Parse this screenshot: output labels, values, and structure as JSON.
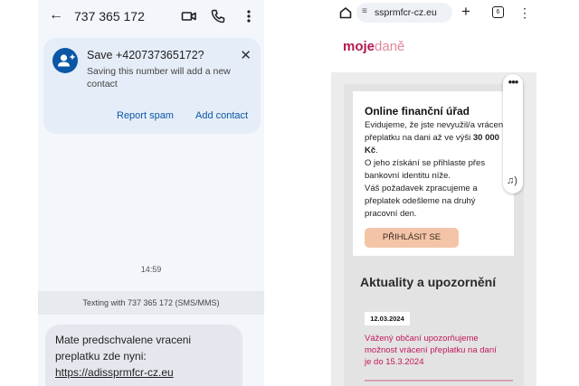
{
  "messages": {
    "header": {
      "number": "737 365 172"
    },
    "save_card": {
      "title": "Save +420737365172?",
      "subtitle": "Saving this number will add a new contact",
      "report_spam": "Report spam",
      "add_contact": "Add contact"
    },
    "timestamp": "14:59",
    "texting_banner": "Texting with 737 365 172 (SMS/MMS)",
    "message": {
      "text": "Mate predschvalene vraceni preplatku zde nyni:",
      "link": "https://adissprmfcr-cz.eu"
    }
  },
  "browser": {
    "url": "ssprmfcr-cz.eu",
    "tab_count": "6",
    "logo": {
      "part1": "moje",
      "part2": "daně"
    },
    "card": {
      "title": "Online finanční úřad",
      "line1": "Evidujeme, že jste nevyužil/a vrácení přeplatku na dani až ve výši ",
      "amount": "30 000 Kč",
      "line2": ".",
      "line3": "O jeho získání se přihlaste přes bankovní identitu níže.",
      "line4": "Váš požadavek zpracujeme a přeplatek odešleme na druhý pracovní den.",
      "button": "PŘIHLÁSIT SE"
    },
    "news": {
      "heading": "Aktuality a upozornění",
      "date": "12.03.2024",
      "link": "Vážený občaní upozorňujeme možnost vrácení přeplatku na daní je do 15.3.2024"
    }
  },
  "colors": {
    "accent_blue": "#0b57a6",
    "brand_red": "#b5174f",
    "button_peach": "#f4c4a8",
    "link_pink": "#c2185b"
  },
  "icons": [
    "back-arrow-icon",
    "video-call-icon",
    "phone-icon",
    "more-vert-icon",
    "add-person-icon",
    "close-icon",
    "home-icon",
    "tune-icon",
    "plus-icon",
    "tabs-icon",
    "speaker-icon"
  ]
}
